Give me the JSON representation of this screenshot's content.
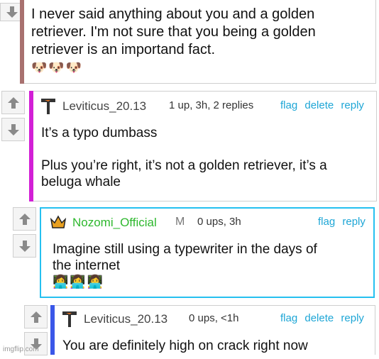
{
  "comments": [
    {
      "body_lines": [
        "I never said anything about you and a golden",
        "retriever. I'm not sure that you being a golden",
        "retriever is an importand fact."
      ],
      "emoji": "🐶🐶🐶",
      "bar_color": "#a8716f"
    },
    {
      "username": "Leviticus_20.13",
      "meta": "1 up, 3h, 2 replies",
      "actions": [
        "flag",
        "delete",
        "reply"
      ],
      "body_lines": [
        "It’s a typo dumbass",
        "",
        "Plus you’re right, it’s not a golden retriever, it’s a",
        "beluga whale"
      ],
      "bar_color": "#d21fd6"
    },
    {
      "username": "Nozomi_Official",
      "badge": "M",
      "meta": "0 ups, 3h",
      "actions": [
        "flag",
        "reply"
      ],
      "body_lines": [
        "Imagine still using a typewriter in the days of",
        "the internet"
      ],
      "emoji": "👩‍💻👩‍💻👩‍💻",
      "bar_color": "#25c0f0",
      "username_color": "#2eb82e"
    },
    {
      "username": "Leviticus_20.13",
      "meta": "0 ups, <1h",
      "actions": [
        "flag",
        "delete",
        "reply"
      ],
      "body_lines": [
        "You are definitely high on crack right now"
      ],
      "bar_color": "#3a57e8"
    }
  ],
  "watermark": "imgflip.com",
  "colors": {
    "link": "#1ea6d6",
    "border": "#cfcfcf"
  }
}
